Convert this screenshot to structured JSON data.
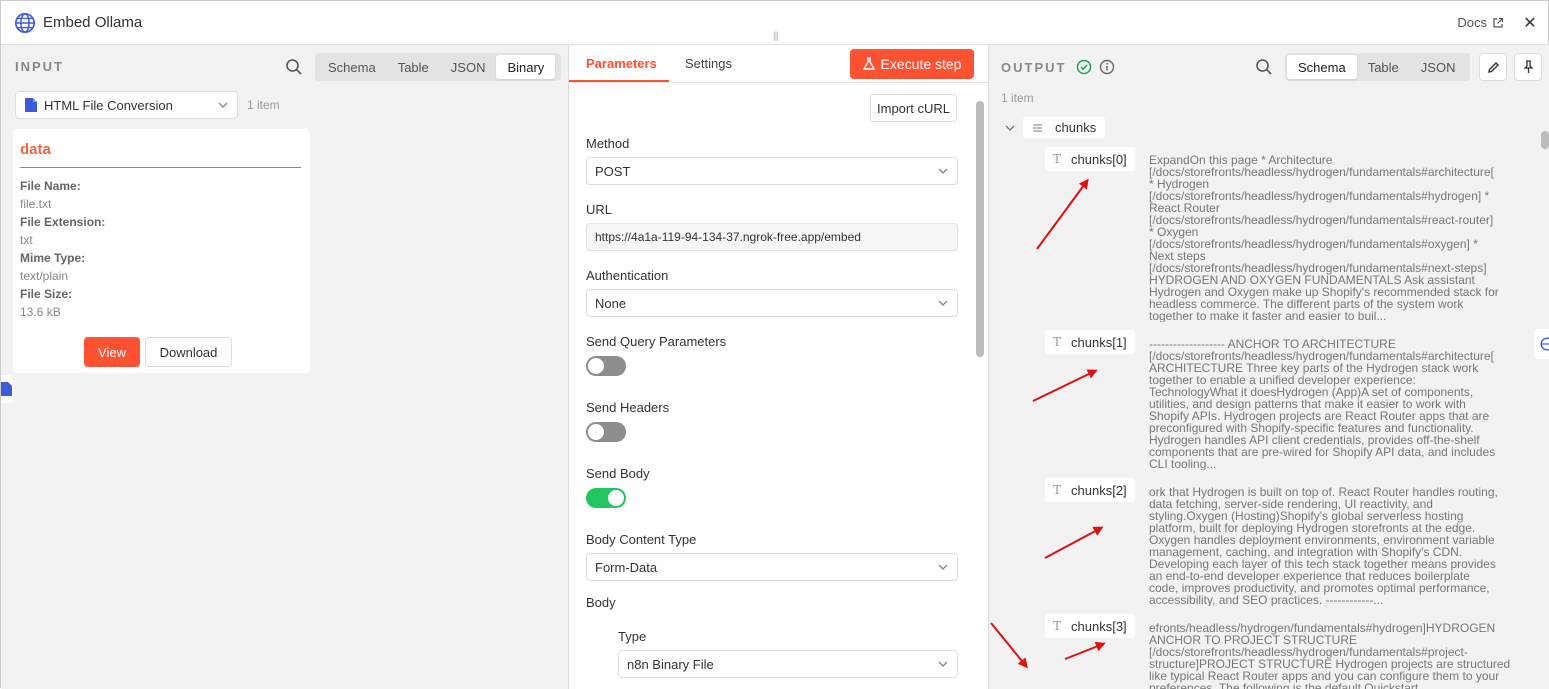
{
  "window": {
    "title": "Embed Ollama",
    "docs_label": "Docs",
    "close_glyph": "✕"
  },
  "input": {
    "label": "INPUT",
    "tabs": [
      "Schema",
      "Table",
      "JSON",
      "Binary"
    ],
    "active_tab": "Binary",
    "node_select": "HTML File Conversion",
    "item_count": "1 item",
    "card": {
      "title": "data",
      "fields": [
        {
          "label": "File Name:",
          "value": "file.txt"
        },
        {
          "label": "File Extension:",
          "value": "txt"
        },
        {
          "label": "Mime Type:",
          "value": "text/plain"
        },
        {
          "label": "File Size:",
          "value": "13.6 kB"
        }
      ],
      "view_label": "View",
      "download_label": "Download"
    }
  },
  "params": {
    "tabs": [
      "Parameters",
      "Settings"
    ],
    "active_tab": "Parameters",
    "execute_label": "Execute step",
    "import_curl": "Import cURL",
    "method_label": "Method",
    "method_value": "POST",
    "url_label": "URL",
    "url_value": "https://4a1a-119-94-134-37.ngrok-free.app/embed",
    "auth_label": "Authentication",
    "auth_value": "None",
    "send_query_label": "Send Query Parameters",
    "send_query_on": false,
    "send_headers_label": "Send Headers",
    "send_headers_on": false,
    "send_body_label": "Send Body",
    "send_body_on": true,
    "body_content_type_label": "Body Content Type",
    "body_content_type_value": "Form-Data",
    "body_label": "Body",
    "type_label": "Type",
    "type_value": "n8n Binary File"
  },
  "output": {
    "label": "OUTPUT",
    "tabs": [
      "Schema",
      "Table",
      "JSON"
    ],
    "active_tab": "Schema",
    "item_count": "1 item",
    "root_key": "chunks",
    "chunks": [
      {
        "key": "chunks[0]",
        "lines": [
          "ExpandOn this page * Architecture",
          "[/docs/storefronts/headless/hydrogen/fundamentals#architecture[",
          "* Hydrogen",
          "[/docs/storefronts/headless/hydrogen/fundamentals#hydrogen] *",
          "React Router",
          "[/docs/storefronts/headless/hydrogen/fundamentals#react-router]",
          "* Oxygen",
          "[/docs/storefronts/headless/hydrogen/fundamentals#oxygen] *",
          "Next steps",
          "[/docs/storefronts/headless/hydrogen/fundamentals#next-steps]",
          "HYDROGEN AND OXYGEN FUNDAMENTALS Ask assistant",
          "Hydrogen and Oxygen make up Shopify's recommended stack for",
          "headless commerce. The different parts of the system work",
          "together to make it faster and easier to buil..."
        ]
      },
      {
        "key": "chunks[1]",
        "lines": [
          "------------------- ANCHOR TO ARCHITECTURE",
          "[/docs/storefronts/headless/hydrogen/fundamentals#architecture[",
          "ARCHITECTURE Three key parts of the Hydrogen stack work",
          "together to enable a unified developer experience:",
          "TechnologyWhat it doesHydrogen (App)A set of components,",
          "utilities, and design patterns that make it easier to work with",
          "Shopify APIs. Hydrogen projects are React Router apps that are",
          "preconfigured with Shopify-specific features and functionality.",
          "Hydrogen handles API client credentials, provides off-the-shelf",
          "components that are pre-wired for Shopify API data, and includes",
          "CLI tooling..."
        ]
      },
      {
        "key": "chunks[2]",
        "lines": [
          "ork that Hydrogen is built on top of. React Router handles routing,",
          "data fetching, server-side rendering, UI reactivity, and",
          "styling.Oxygen (Hosting)Shopify's global serverless hosting",
          "platform, built for deploying Hydrogen storefronts at the edge.",
          "Oxygen handles deployment environments, environment variable",
          "management, caching, and integration with Shopify's CDN.",
          "Developing each layer of this tech stack together means provides",
          "an end-to-end developer experience that reduces boilerplate",
          "code, improves productivity, and promotes optimal performance,",
          "accessibility, and SEO practices. ------------..."
        ]
      },
      {
        "key": "chunks[3]",
        "lines": [
          "efronts/headless/hydrogen/fundamentals#hydrogen]HYDROGEN",
          "ANCHOR TO PROJECT STRUCTURE",
          "[/docs/storefronts/headless/hydrogen/fundamentals#project-",
          "structure]PROJECT STRUCTURE Hydrogen projects are structured",
          "like typical React Router apps and you can configure them to your",
          "preferences. The following is the default Quickstart..."
        ]
      }
    ]
  },
  "colors": {
    "accent": "#ff5233",
    "toggle_on": "#22c55e",
    "toggle_off": "#8d8d8d",
    "annotation": "#e01010"
  }
}
